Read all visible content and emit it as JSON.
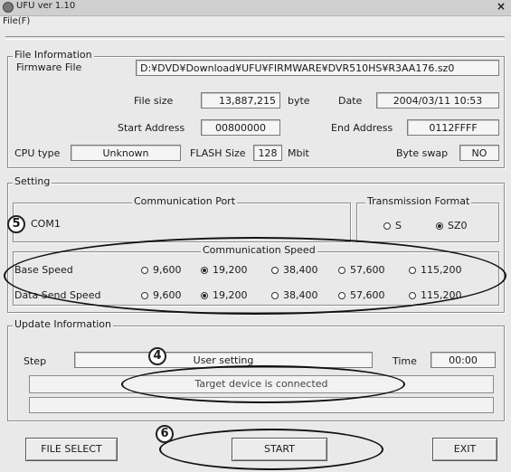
{
  "window": {
    "title": "UFU  ver 1.10",
    "close_glyph": "×",
    "icon": "app-icon"
  },
  "menu": {
    "file": "File(F)"
  },
  "file_info": {
    "legend": "File Information",
    "firmware_label": "Firmware File",
    "firmware_path": "D:¥DVD¥Download¥UFU¥FIRMWARE¥DVR510HS¥R3AA176.sz0",
    "file_size_label": "File size",
    "file_size_value": "13,887,215",
    "file_size_unit": "byte",
    "date_label": "Date",
    "date_value": "2004/03/11 10:53",
    "start_address_label": "Start Address",
    "start_address_value": "00800000",
    "end_address_label": "End Address",
    "end_address_value": "0112FFFF",
    "cpu_label": "CPU type",
    "cpu_value": "Unknown",
    "flash_label": "FLASH Size",
    "flash_value": "128",
    "flash_unit": "Mbit",
    "swap_label": "Byte swap",
    "swap_value": "NO"
  },
  "setting": {
    "legend": "Setting",
    "comm_port_legend": "Communication Port",
    "comm_port_value": "COM1",
    "tx_format_legend": "Transmission Format",
    "tx_options": [
      {
        "label": "S",
        "selected": false
      },
      {
        "label": "SZ0",
        "selected": true
      }
    ],
    "speed_legend": "Communication Speed",
    "base_label": "Base Speed",
    "data_label": "Data Send Speed",
    "speed_options": [
      "9,600",
      "19,200",
      "38,400",
      "57,600",
      "115,200"
    ],
    "base_selected": "19,200",
    "data_selected": "19,200"
  },
  "update_info": {
    "legend": "Update Information",
    "step_label": "Step",
    "step_value": "User setting",
    "time_label": "Time",
    "time_value": "00:00",
    "status_message": "Target device is connected",
    "progress": 0
  },
  "buttons": {
    "file_select": "FILE SELECT",
    "start": "START",
    "exit": "EXIT"
  },
  "callouts": {
    "n4": "4",
    "n5": "5",
    "n6": "6"
  }
}
